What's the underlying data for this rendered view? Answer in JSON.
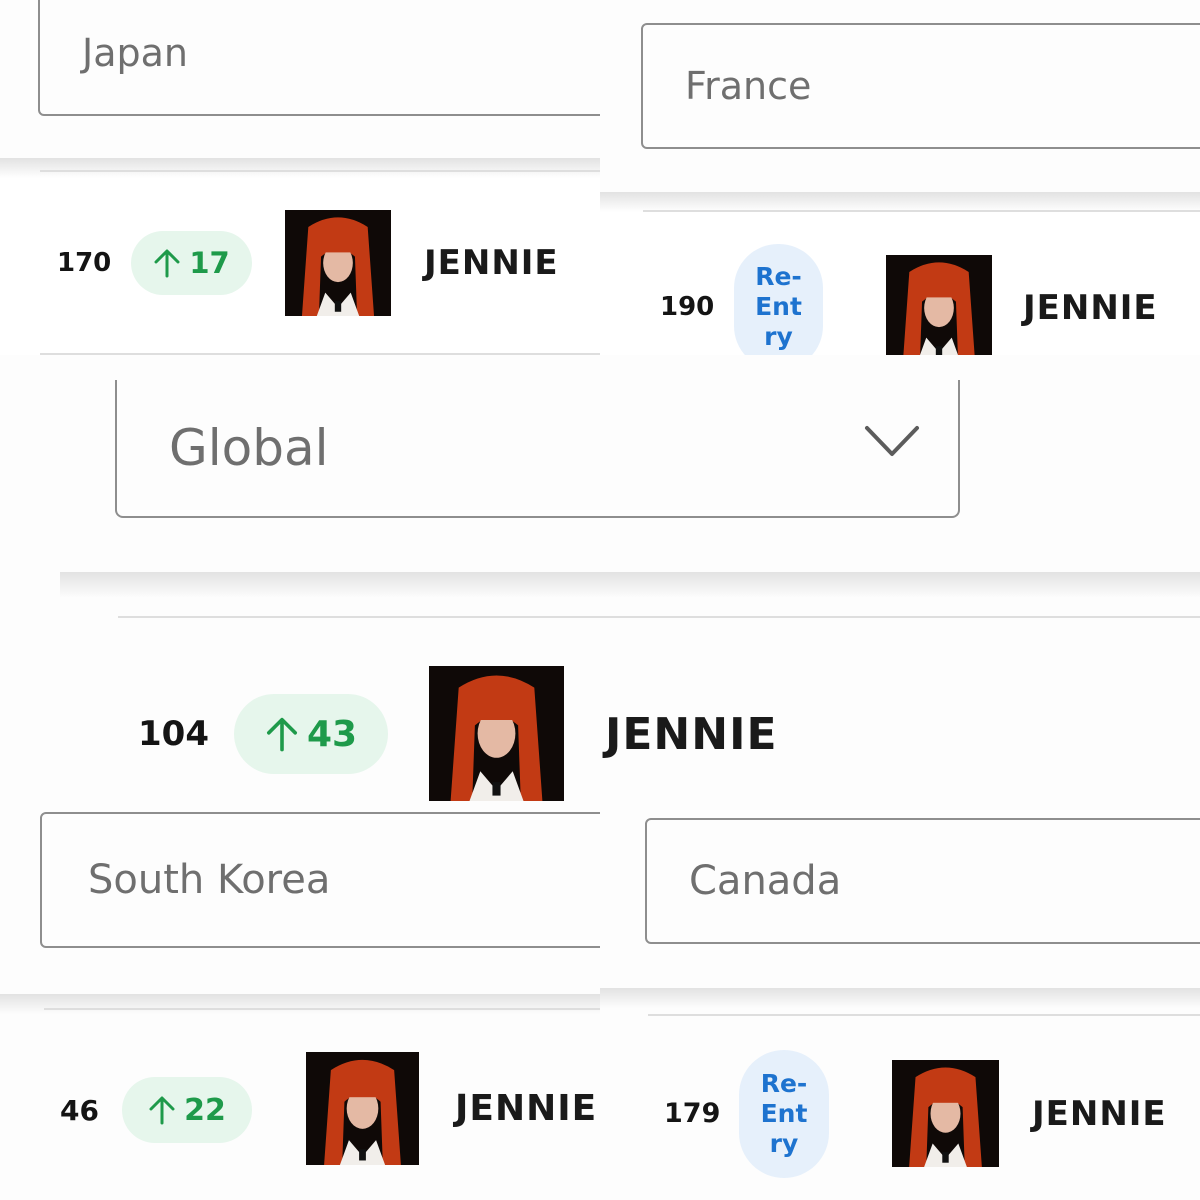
{
  "blocks": [
    {
      "country": "Japan",
      "rank": "170",
      "badge": {
        "type": "up",
        "value": "17"
      },
      "artist": "JENNIE"
    },
    {
      "country": "France",
      "rank": "190",
      "badge": {
        "type": "reentry",
        "lines": [
          "Re-",
          "Ent",
          "ry"
        ]
      },
      "artist": "JENNIE"
    },
    {
      "country": "Global",
      "rank": "104",
      "badge": {
        "type": "up",
        "value": "43"
      },
      "artist": "JENNIE"
    },
    {
      "country": "South Korea",
      "rank": "46",
      "badge": {
        "type": "up",
        "value": "22"
      },
      "artist": "JENNIE"
    },
    {
      "country": "Canada",
      "rank": "179",
      "badge": {
        "type": "reentry",
        "lines": [
          "Re-",
          "Ent",
          "ry"
        ]
      },
      "artist": "JENNIE"
    }
  ],
  "icons": {
    "arrow": "arrow-up-icon",
    "chevron": "chevron-down-icon",
    "art": "album-art-icon"
  },
  "colors": {
    "up_bg": "#e6f6ec",
    "up_fg": "#1e9a4a",
    "reentry_bg": "#e6f0fb",
    "reentry_fg": "#1e73cf",
    "hair": "#c23a14"
  }
}
